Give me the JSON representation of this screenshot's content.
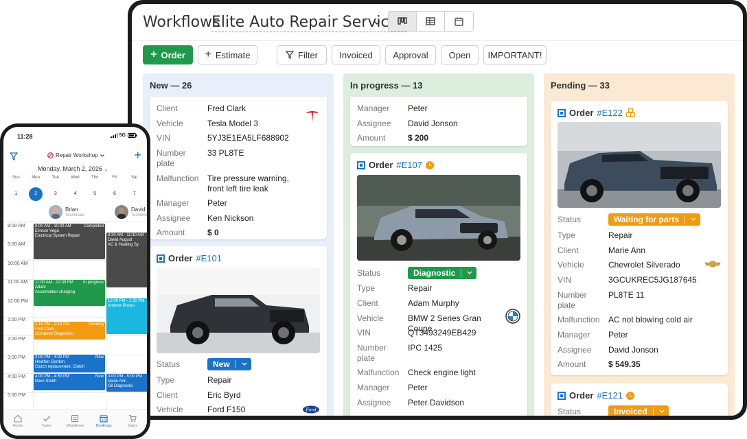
{
  "workflows": {
    "title": "Workflows",
    "company": "Elite Auto Repair Services",
    "views": [
      "kanban-icon",
      "table-icon",
      "calendar-icon"
    ],
    "active_view": "kanban-icon"
  },
  "toolbar": {
    "order_label": "Order",
    "estimate_label": "Estimate",
    "filter_label": "Filter",
    "chips": [
      "Invoiced",
      "Approval",
      "Open",
      "IMPORTANT!"
    ],
    "accent": "#1f9a4a"
  },
  "columns": {
    "new": {
      "title": "New — 26",
      "card1": {
        "client_k": "Client",
        "client": "Fred Clark",
        "vehicle_k": "Vehicle",
        "vehicle": "Tesla Model 3",
        "vin_k": "VIN",
        "vin": "5YJ3E1EA5LF688902",
        "plate_k": "Number plate",
        "plate": "33 PL8TE",
        "malf_k": "Malfunction",
        "malf": "Tire pressure warning, front left tire leak",
        "manager_k": "Manager",
        "manager": "Peter",
        "assignee_k": "Assignee",
        "assignee": "Ken Nickson",
        "amount_k": "Amount",
        "amount": "$ 0",
        "brand": "tesla-logo-icon"
      },
      "card2": {
        "order_label": "Order",
        "order_no": "#E101",
        "status_k": "Status",
        "status": "New",
        "status_color": "#1a73c8",
        "type_k": "Type",
        "type": "Repair",
        "client_k": "Client",
        "client": "Eric Byrd",
        "vehicle_k": "Vehicle",
        "vehicle": "Ford F150",
        "brand": "ford-logo-icon"
      }
    },
    "progress": {
      "title": "In progress — 13",
      "card1": {
        "manager_k": "Manager",
        "manager": "Peter",
        "assignee_k": "Assignee",
        "assignee": "David Jonson",
        "amount_k": "Amount",
        "amount": "$ 200"
      },
      "card2": {
        "order_label": "Order",
        "order_no": "#E107",
        "status_k": "Status",
        "status": "Diagnostic",
        "status_color": "#1f9a4a",
        "type_k": "Type",
        "type": "Repair",
        "client_k": "Client",
        "client": "Adam Murphy",
        "vehicle_k": "Vehicle",
        "vehicle": "BMW 2 Series Gran Coupe",
        "vin_k": "VIN",
        "vin": "QT3493249EB429",
        "plate_k": "Number plate",
        "plate": "IPC 1425",
        "malf_k": "Malfunction",
        "malf": "Check engine light",
        "manager_k": "Manager",
        "manager": "Peter",
        "assignee_k": "Assignee",
        "assignee": "Peter Davidson",
        "brand": "bmw-logo-icon"
      }
    },
    "pending": {
      "title": "Pending — 33",
      "card1": {
        "order_label": "Order",
        "order_no": "#E122",
        "status_k": "Status",
        "status": "Waiting for parts",
        "status_color": "#f29b12",
        "type_k": "Type",
        "type": "Repair",
        "client_k": "Client",
        "client": "Marie Ann",
        "vehicle_k": "Vehicle",
        "vehicle": "Chevrolet Silverado",
        "vin_k": "VIN",
        "vin": "3GCUKREC5JG187645",
        "plate_k": "Number plate",
        "plate": "PL8TE 11",
        "malf_k": "Malfunction",
        "malf": "AC not blowing cold air",
        "manager_k": "Manager",
        "manager": "Peter",
        "assignee_k": "Assignee",
        "assignee": "David Jonson",
        "amount_k": "Amount",
        "amount": "$ 549.35",
        "brand": "chevrolet-logo-icon"
      },
      "card2": {
        "order_label": "Order",
        "order_no": "#E121",
        "status_k": "Status",
        "status": "Invoiced",
        "status_color": "#f29b12"
      }
    }
  },
  "phone": {
    "time": "11:28",
    "network": "5G",
    "workshop": "Repair Workshop",
    "date": "Monday, March 2, 2026",
    "weekdays": [
      "Sun",
      "Mon",
      "Tue",
      "Wed",
      "Thu",
      "Fri",
      "Sat"
    ],
    "days": [
      "1",
      "2",
      "3",
      "4",
      "5",
      "6",
      "7"
    ],
    "selected_day": "2",
    "tech1": {
      "name": "Brian",
      "role": "Technician"
    },
    "tech2": {
      "name": "David",
      "role": "Technician"
    },
    "hours": [
      "8:00 AM",
      "9:00 AM",
      "10:00 AM",
      "11:00 AM",
      "12:00 PM",
      "1:00 PM",
      "2:00 PM",
      "3:00 PM",
      "4:00 PM",
      "5:00 PM"
    ],
    "events": {
      "e1": {
        "time": "8:00 AM - 10:00 AM",
        "tag": "Completed",
        "who": "Elinsse Vega",
        "what": "Electrical System Repair",
        "color": "#4a4a4a"
      },
      "e2": {
        "time": "11:00 AM - 12:30 PM",
        "tag": "In progress",
        "who": "Adam",
        "what": "Accumulator charging",
        "color": "#1f9a4a"
      },
      "e3": {
        "time": "1:15 PM - 2:15 PM",
        "tag": "Pending",
        "who": "Fred Clark",
        "what": "Computer Diagnostic",
        "color": "#f29b12"
      },
      "e4": {
        "time": "3:00 PM - 4:00 PM",
        "tag": "New",
        "who": "Heather Gordon",
        "what": "Clutch replacement, Clutch",
        "color": "#1a73c8"
      },
      "e5": {
        "time": "4:00 PM - 4:50 PM",
        "tag": "New",
        "who": "Dave Smith",
        "what": "",
        "color": "#1a73c8"
      },
      "e6": {
        "time": "8:30 AM - 11:30 AM",
        "who": "David August",
        "what": "AC & Heating Sy",
        "color": "#4a4a4a"
      },
      "e7": {
        "time": "12:00 PM - 1:30 PM",
        "who": "Andrew Brown",
        "color": "#19b8e0"
      },
      "e8": {
        "time": "4:00 PM - 5:00 PM",
        "who": "Marie Ann",
        "what": "Oil Diagnostic",
        "color": "#1a73c8"
      }
    },
    "nav": [
      "Home",
      "Tasks",
      "Workflows",
      "Bookings",
      "Sales"
    ],
    "active_nav": "Bookings"
  }
}
